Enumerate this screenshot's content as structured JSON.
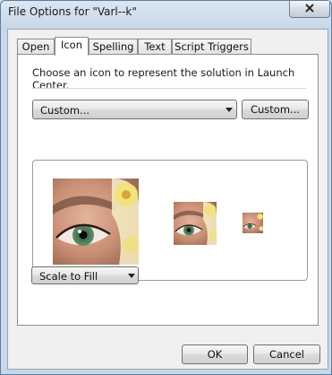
{
  "window": {
    "title": "File Options for \"Varl--k\""
  },
  "tabs": [
    {
      "label": "Open"
    },
    {
      "label": "Icon"
    },
    {
      "label": "Spelling"
    },
    {
      "label": "Text"
    },
    {
      "label": "Script Triggers"
    }
  ],
  "active_tab": "Icon",
  "icon_panel": {
    "instruction": "Choose an icon to represent the solution in Launch Center.",
    "icon_source_selected": "Custom...",
    "custom_button": "Custom...",
    "scaling_selected": "Scale to Fill"
  },
  "footer": {
    "ok": "OK",
    "cancel": "Cancel"
  },
  "icons": {
    "close": "close-x-icon",
    "dropdown": "chevron-down-icon"
  }
}
